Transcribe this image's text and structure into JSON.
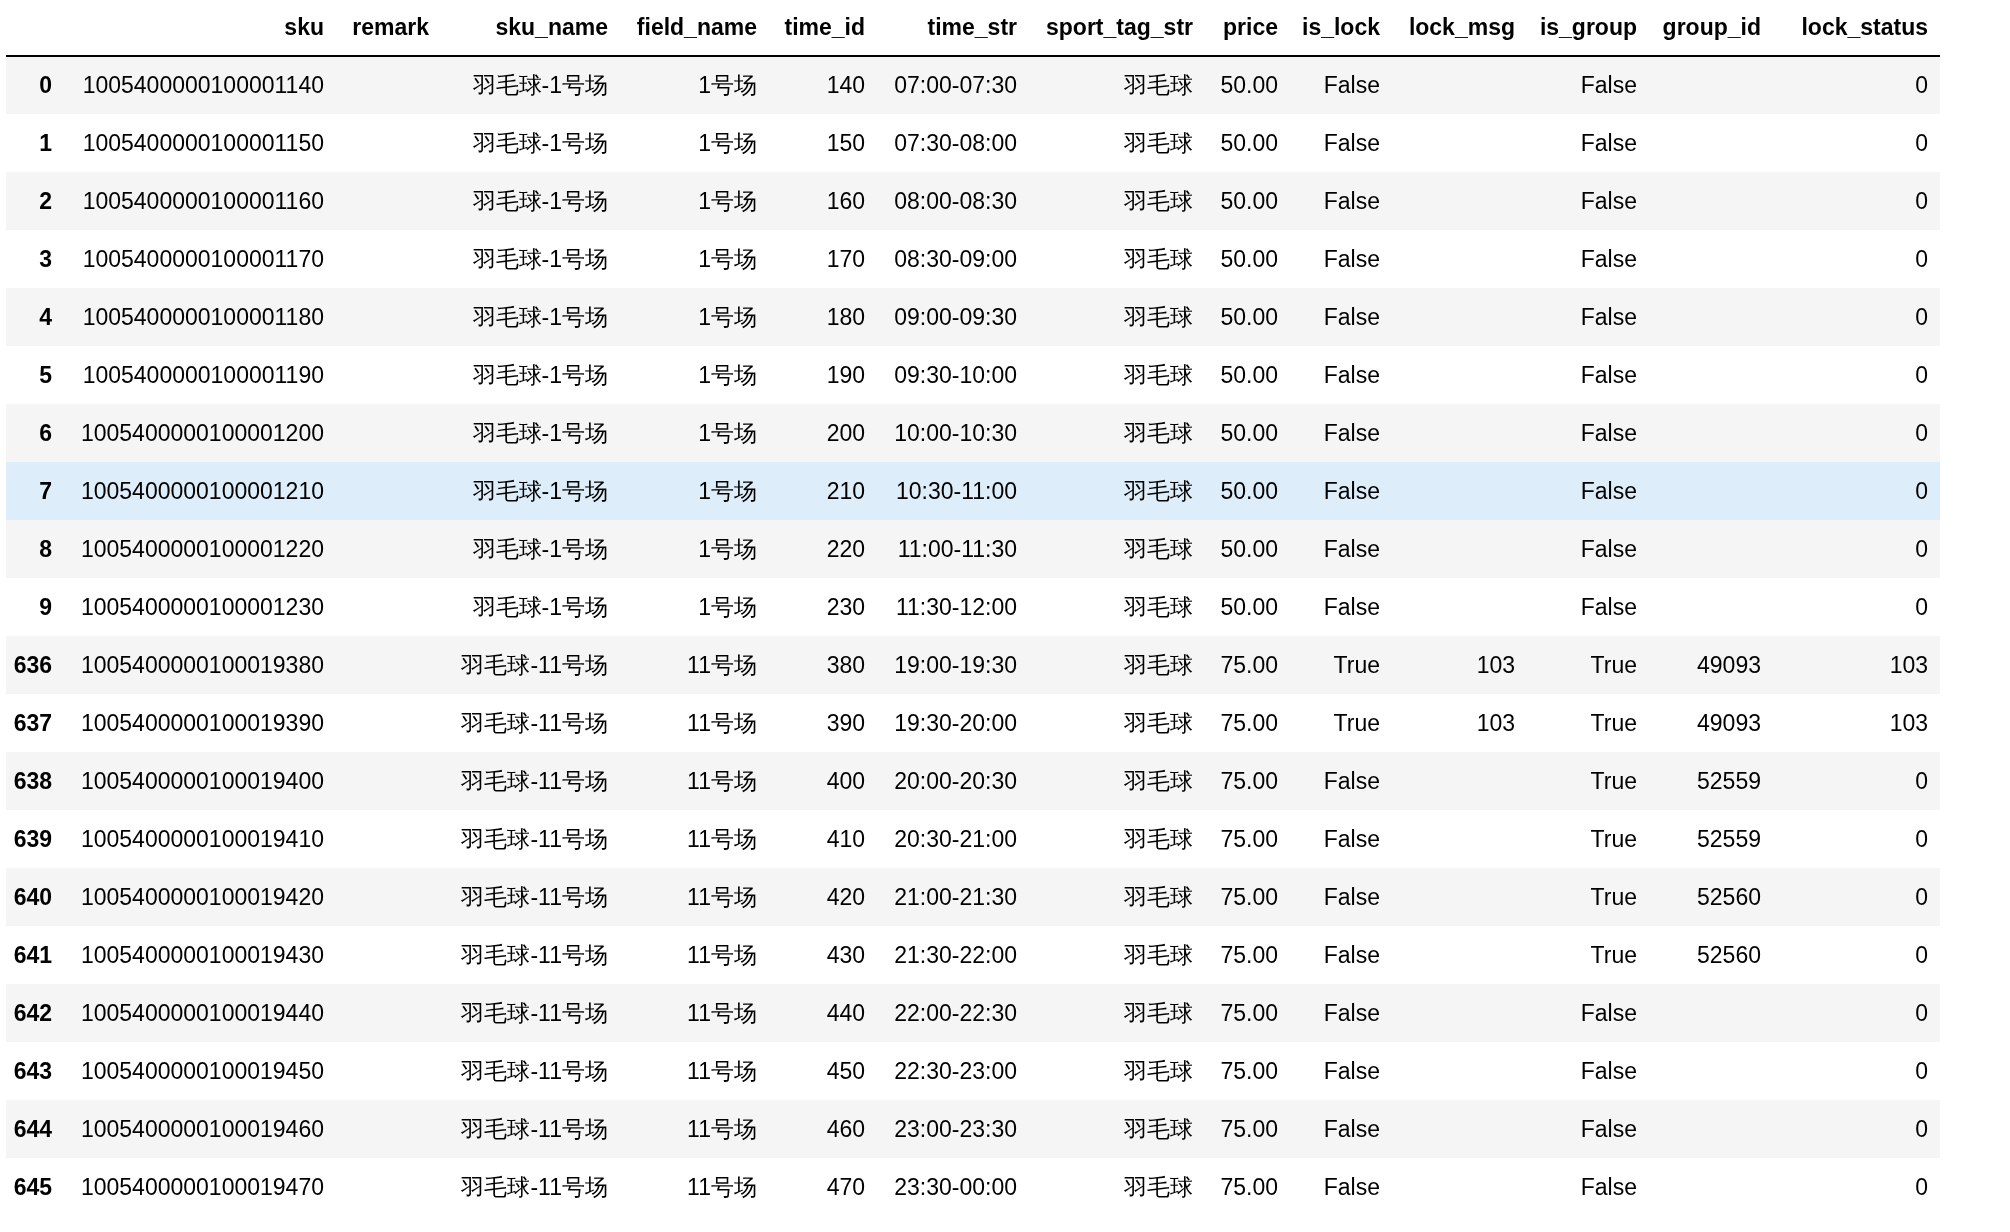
{
  "table": {
    "columns": [
      "sku",
      "remark",
      "sku_name",
      "field_name",
      "time_id",
      "time_str",
      "sport_tag_str",
      "price",
      "is_lock",
      "lock_msg",
      "is_group",
      "group_id",
      "lock_status"
    ],
    "rows": [
      {
        "index": "0",
        "selected": false,
        "cells": [
          "1005400000100001140",
          null,
          "羽毛球-1号场",
          "1号场",
          "140",
          "07:00-07:30",
          "羽毛球",
          "50.00",
          "False",
          null,
          "False",
          null,
          "0"
        ]
      },
      {
        "index": "1",
        "selected": false,
        "cells": [
          "1005400000100001150",
          null,
          "羽毛球-1号场",
          "1号场",
          "150",
          "07:30-08:00",
          "羽毛球",
          "50.00",
          "False",
          null,
          "False",
          null,
          "0"
        ]
      },
      {
        "index": "2",
        "selected": false,
        "cells": [
          "1005400000100001160",
          null,
          "羽毛球-1号场",
          "1号场",
          "160",
          "08:00-08:30",
          "羽毛球",
          "50.00",
          "False",
          null,
          "False",
          null,
          "0"
        ]
      },
      {
        "index": "3",
        "selected": false,
        "cells": [
          "1005400000100001170",
          null,
          "羽毛球-1号场",
          "1号场",
          "170",
          "08:30-09:00",
          "羽毛球",
          "50.00",
          "False",
          null,
          "False",
          null,
          "0"
        ]
      },
      {
        "index": "4",
        "selected": false,
        "cells": [
          "1005400000100001180",
          null,
          "羽毛球-1号场",
          "1号场",
          "180",
          "09:00-09:30",
          "羽毛球",
          "50.00",
          "False",
          null,
          "False",
          null,
          "0"
        ]
      },
      {
        "index": "5",
        "selected": false,
        "cells": [
          "1005400000100001190",
          null,
          "羽毛球-1号场",
          "1号场",
          "190",
          "09:30-10:00",
          "羽毛球",
          "50.00",
          "False",
          null,
          "False",
          null,
          "0"
        ]
      },
      {
        "index": "6",
        "selected": false,
        "cells": [
          "1005400000100001200",
          null,
          "羽毛球-1号场",
          "1号场",
          "200",
          "10:00-10:30",
          "羽毛球",
          "50.00",
          "False",
          null,
          "False",
          null,
          "0"
        ]
      },
      {
        "index": "7",
        "selected": true,
        "cells": [
          "1005400000100001210",
          null,
          "羽毛球-1号场",
          "1号场",
          "210",
          "10:30-11:00",
          "羽毛球",
          "50.00",
          "False",
          null,
          "False",
          null,
          "0"
        ]
      },
      {
        "index": "8",
        "selected": false,
        "cells": [
          "1005400000100001220",
          null,
          "羽毛球-1号场",
          "1号场",
          "220",
          "11:00-11:30",
          "羽毛球",
          "50.00",
          "False",
          null,
          "False",
          null,
          "0"
        ]
      },
      {
        "index": "9",
        "selected": false,
        "cells": [
          "1005400000100001230",
          null,
          "羽毛球-1号场",
          "1号场",
          "230",
          "11:30-12:00",
          "羽毛球",
          "50.00",
          "False",
          null,
          "False",
          null,
          "0"
        ]
      },
      {
        "index": "636",
        "selected": false,
        "cells": [
          "1005400000100019380",
          null,
          "羽毛球-11号场",
          "11号场",
          "380",
          "19:00-19:30",
          "羽毛球",
          "75.00",
          "True",
          "103",
          "True",
          "49093",
          "103"
        ]
      },
      {
        "index": "637",
        "selected": false,
        "cells": [
          "1005400000100019390",
          null,
          "羽毛球-11号场",
          "11号场",
          "390",
          "19:30-20:00",
          "羽毛球",
          "75.00",
          "True",
          "103",
          "True",
          "49093",
          "103"
        ]
      },
      {
        "index": "638",
        "selected": false,
        "cells": [
          "1005400000100019400",
          null,
          "羽毛球-11号场",
          "11号场",
          "400",
          "20:00-20:30",
          "羽毛球",
          "75.00",
          "False",
          null,
          "True",
          "52559",
          "0"
        ]
      },
      {
        "index": "639",
        "selected": false,
        "cells": [
          "1005400000100019410",
          null,
          "羽毛球-11号场",
          "11号场",
          "410",
          "20:30-21:00",
          "羽毛球",
          "75.00",
          "False",
          null,
          "True",
          "52559",
          "0"
        ]
      },
      {
        "index": "640",
        "selected": false,
        "cells": [
          "1005400000100019420",
          null,
          "羽毛球-11号场",
          "11号场",
          "420",
          "21:00-21:30",
          "羽毛球",
          "75.00",
          "False",
          null,
          "True",
          "52560",
          "0"
        ]
      },
      {
        "index": "641",
        "selected": false,
        "cells": [
          "1005400000100019430",
          null,
          "羽毛球-11号场",
          "11号场",
          "430",
          "21:30-22:00",
          "羽毛球",
          "75.00",
          "False",
          null,
          "True",
          "52560",
          "0"
        ]
      },
      {
        "index": "642",
        "selected": false,
        "cells": [
          "1005400000100019440",
          null,
          "羽毛球-11号场",
          "11号场",
          "440",
          "22:00-22:30",
          "羽毛球",
          "75.00",
          "False",
          null,
          "False",
          null,
          "0"
        ]
      },
      {
        "index": "643",
        "selected": false,
        "cells": [
          "1005400000100019450",
          null,
          "羽毛球-11号场",
          "11号场",
          "450",
          "22:30-23:00",
          "羽毛球",
          "75.00",
          "False",
          null,
          "False",
          null,
          "0"
        ]
      },
      {
        "index": "644",
        "selected": false,
        "cells": [
          "1005400000100019460",
          null,
          "羽毛球-11号场",
          "11号场",
          "460",
          "23:00-23:30",
          "羽毛球",
          "75.00",
          "False",
          null,
          "False",
          null,
          "0"
        ]
      },
      {
        "index": "645",
        "selected": false,
        "cells": [
          "1005400000100019470",
          null,
          "羽毛球-11号场",
          "11号场",
          "470",
          "23:30-00:00",
          "羽毛球",
          "75.00",
          "False",
          null,
          "False",
          null,
          "0"
        ]
      }
    ]
  }
}
